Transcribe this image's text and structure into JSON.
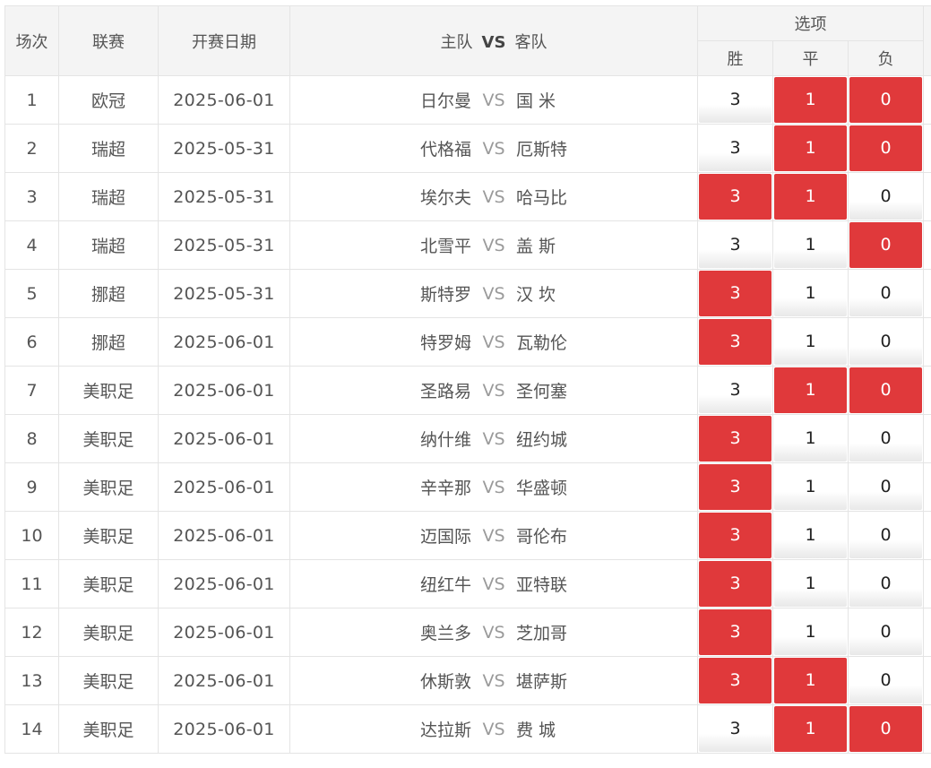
{
  "header": {
    "col_num": "场次",
    "col_league": "联赛",
    "col_date": "开赛日期",
    "col_home": "主队",
    "col_vs": "VS",
    "col_away": "客队",
    "col_options": "选项",
    "opt_win": "胜",
    "opt_draw": "平",
    "opt_lose": "负"
  },
  "colors": {
    "selected": "#e0393b",
    "header_bg": "#f4f4f4",
    "border": "#e4e4e4"
  },
  "rows": [
    {
      "num": "1",
      "league": "欧冠",
      "date": "2025-06-01",
      "home": "日尔曼",
      "vs": "VS",
      "away": "国 米",
      "win": "3",
      "draw": "1",
      "lose": "0",
      "sel_win": false,
      "sel_draw": true,
      "sel_lose": true
    },
    {
      "num": "2",
      "league": "瑞超",
      "date": "2025-05-31",
      "home": "代格福",
      "vs": "VS",
      "away": "厄斯特",
      "win": "3",
      "draw": "1",
      "lose": "0",
      "sel_win": false,
      "sel_draw": true,
      "sel_lose": true
    },
    {
      "num": "3",
      "league": "瑞超",
      "date": "2025-05-31",
      "home": "埃尔夫",
      "vs": "VS",
      "away": "哈马比",
      "win": "3",
      "draw": "1",
      "lose": "0",
      "sel_win": true,
      "sel_draw": true,
      "sel_lose": false
    },
    {
      "num": "4",
      "league": "瑞超",
      "date": "2025-05-31",
      "home": "北雪平",
      "vs": "VS",
      "away": "盖 斯",
      "win": "3",
      "draw": "1",
      "lose": "0",
      "sel_win": false,
      "sel_draw": false,
      "sel_lose": true
    },
    {
      "num": "5",
      "league": "挪超",
      "date": "2025-05-31",
      "home": "斯特罗",
      "vs": "VS",
      "away": "汉 坎",
      "win": "3",
      "draw": "1",
      "lose": "0",
      "sel_win": true,
      "sel_draw": false,
      "sel_lose": false
    },
    {
      "num": "6",
      "league": "挪超",
      "date": "2025-06-01",
      "home": "特罗姆",
      "vs": "VS",
      "away": "瓦勒伦",
      "win": "3",
      "draw": "1",
      "lose": "0",
      "sel_win": true,
      "sel_draw": false,
      "sel_lose": false
    },
    {
      "num": "7",
      "league": "美职足",
      "date": "2025-06-01",
      "home": "圣路易",
      "vs": "VS",
      "away": "圣何塞",
      "win": "3",
      "draw": "1",
      "lose": "0",
      "sel_win": false,
      "sel_draw": true,
      "sel_lose": true
    },
    {
      "num": "8",
      "league": "美职足",
      "date": "2025-06-01",
      "home": "纳什维",
      "vs": "VS",
      "away": "纽约城",
      "win": "3",
      "draw": "1",
      "lose": "0",
      "sel_win": true,
      "sel_draw": false,
      "sel_lose": false
    },
    {
      "num": "9",
      "league": "美职足",
      "date": "2025-06-01",
      "home": "辛辛那",
      "vs": "VS",
      "away": "华盛顿",
      "win": "3",
      "draw": "1",
      "lose": "0",
      "sel_win": true,
      "sel_draw": false,
      "sel_lose": false
    },
    {
      "num": "10",
      "league": "美职足",
      "date": "2025-06-01",
      "home": "迈国际",
      "vs": "VS",
      "away": "哥伦布",
      "win": "3",
      "draw": "1",
      "lose": "0",
      "sel_win": true,
      "sel_draw": false,
      "sel_lose": false
    },
    {
      "num": "11",
      "league": "美职足",
      "date": "2025-06-01",
      "home": "纽红牛",
      "vs": "VS",
      "away": "亚特联",
      "win": "3",
      "draw": "1",
      "lose": "0",
      "sel_win": true,
      "sel_draw": false,
      "sel_lose": false
    },
    {
      "num": "12",
      "league": "美职足",
      "date": "2025-06-01",
      "home": "奥兰多",
      "vs": "VS",
      "away": "芝加哥",
      "win": "3",
      "draw": "1",
      "lose": "0",
      "sel_win": true,
      "sel_draw": false,
      "sel_lose": false
    },
    {
      "num": "13",
      "league": "美职足",
      "date": "2025-06-01",
      "home": "休斯敦",
      "vs": "VS",
      "away": "堪萨斯",
      "win": "3",
      "draw": "1",
      "lose": "0",
      "sel_win": true,
      "sel_draw": true,
      "sel_lose": false
    },
    {
      "num": "14",
      "league": "美职足",
      "date": "2025-06-01",
      "home": "达拉斯",
      "vs": "VS",
      "away": "费 城",
      "win": "3",
      "draw": "1",
      "lose": "0",
      "sel_win": false,
      "sel_draw": true,
      "sel_lose": true
    }
  ]
}
